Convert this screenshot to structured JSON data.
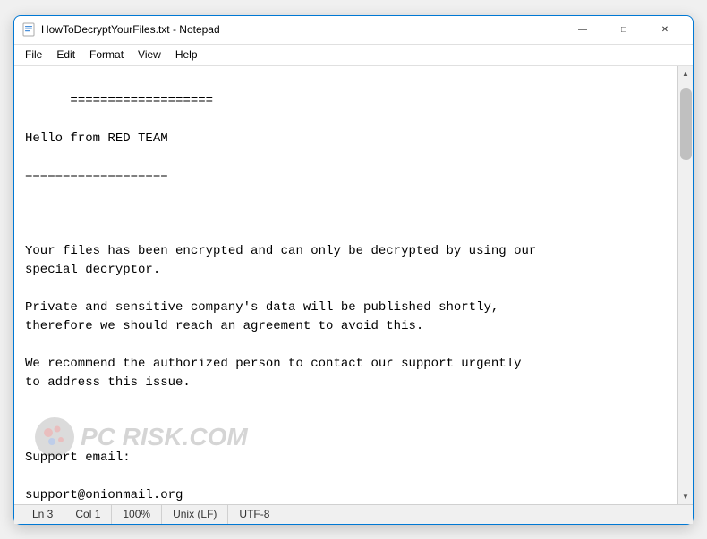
{
  "window": {
    "title": "HowToDecryptYourFiles.txt - Notepad",
    "app_icon": "notepad"
  },
  "titlebar_controls": {
    "minimize": "—",
    "maximize": "□",
    "close": "✕"
  },
  "menubar": {
    "items": [
      "File",
      "Edit",
      "Format",
      "View",
      "Help"
    ]
  },
  "content": {
    "text": "===================\n\nHello from RED TEAM\n\n===================\n\n\n\nYour files has been encrypted and can only be decrypted by using our\nspecial decryptor.\n\nPrivate and sensitive company's data will be published shortly,\ntherefore we should reach an agreement to avoid this.\n\nWe recommend the authorized person to contact our support urgently\nto address this issue.\n\n\n\nSupport email:\n\nsupport@onionmail.org"
  },
  "statusbar": {
    "line": "Ln 3",
    "col": "Col 1",
    "zoom": "100%",
    "line_ending": "Unix (LF)",
    "encoding": "UTF-8"
  },
  "watermark": {
    "text": "PC RISK.COM"
  }
}
